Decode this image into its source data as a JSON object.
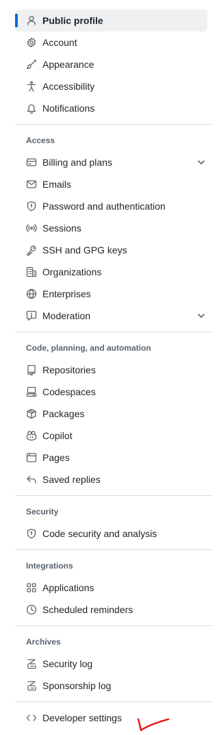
{
  "profile_group": [
    {
      "label": "Public profile",
      "icon": "person-icon",
      "active": true
    },
    {
      "label": "Account",
      "icon": "gear-icon"
    },
    {
      "label": "Appearance",
      "icon": "paintbrush-icon"
    },
    {
      "label": "Accessibility",
      "icon": "accessibility-icon"
    },
    {
      "label": "Notifications",
      "icon": "bell-icon"
    }
  ],
  "sections": {
    "access": {
      "heading": "Access",
      "items": [
        {
          "label": "Billing and plans",
          "icon": "credit-card-icon"
        },
        {
          "label": "Emails",
          "icon": "mail-icon"
        },
        {
          "label": "Password and authentication",
          "icon": "shield-lock-icon"
        },
        {
          "label": "Sessions",
          "icon": "broadcast-icon"
        },
        {
          "label": "SSH and GPG keys",
          "icon": "key-icon"
        },
        {
          "label": "Organizations",
          "icon": "organization-icon"
        },
        {
          "label": "Enterprises",
          "icon": "globe-icon"
        },
        {
          "label": "Moderation",
          "icon": "report-icon"
        }
      ]
    },
    "code": {
      "heading": "Code, planning, and automation",
      "items": [
        {
          "label": "Repositories",
          "icon": "repo-icon"
        },
        {
          "label": "Codespaces",
          "icon": "codespaces-icon"
        },
        {
          "label": "Packages",
          "icon": "package-icon"
        },
        {
          "label": "Copilot",
          "icon": "copilot-icon"
        },
        {
          "label": "Pages",
          "icon": "browser-icon"
        },
        {
          "label": "Saved replies",
          "icon": "reply-icon"
        }
      ]
    },
    "security": {
      "heading": "Security",
      "items": [
        {
          "label": "Code security and analysis",
          "icon": "shield-lock-icon"
        }
      ]
    },
    "integrations": {
      "heading": "Integrations",
      "items": [
        {
          "label": "Applications",
          "icon": "apps-icon"
        },
        {
          "label": "Scheduled reminders",
          "icon": "clock-icon"
        }
      ]
    },
    "archives": {
      "heading": "Archives",
      "items": [
        {
          "label": "Security log",
          "icon": "log-icon"
        },
        {
          "label": "Sponsorship log",
          "icon": "log-icon"
        }
      ]
    }
  },
  "developer": {
    "label": "Developer settings",
    "icon": "code-icon"
  },
  "colors": {
    "accent": "#0969da",
    "active_bg": "#eef0f2",
    "annotation": "#e0201b"
  }
}
